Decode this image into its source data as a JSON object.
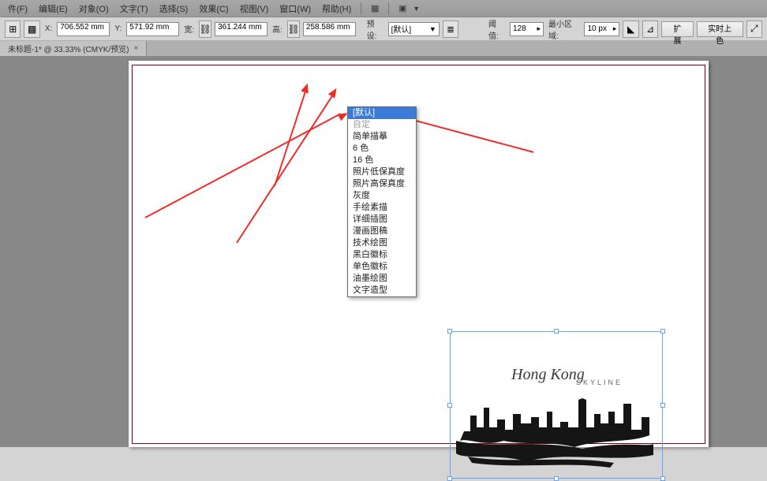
{
  "menu": [
    "件(F)",
    "编辑(E)",
    "对象(O)",
    "文字(T)",
    "选择(S)",
    "效果(C)",
    "视图(V)",
    "窗口(W)",
    "帮助(H)"
  ],
  "toolbar": {
    "x_label": "X:",
    "x_value": "706.552 mm",
    "y_label": "Y:",
    "y_value": "571.92 mm",
    "w_label": "宽:",
    "w_value": "361.244 mm",
    "h_label": "高:",
    "h_value": "258.586 mm",
    "preset_label": "预设:",
    "preset_value": "[默认]",
    "threshold_label": "阈值:",
    "threshold_value": "128",
    "minarea_label": "最小区域:",
    "minarea_value": "10 px",
    "expand_btn": "扩展",
    "live_btn": "实时上色"
  },
  "tab": {
    "title": "未标题-1* @ 33.33% (CMYK/预览)"
  },
  "dropdown": {
    "items": [
      "[默认]",
      "自定",
      "简单描摹",
      "6 色",
      "16 色",
      "照片低保真度",
      "照片高保真度",
      "灰度",
      "手绘素描",
      "详细插图",
      "漫画图稿",
      "技术绘图",
      "黑白徽标",
      "单色徽标",
      "油墨绘图",
      "文字造型"
    ],
    "selected_index": 0,
    "disabled_index": 1
  },
  "art": {
    "title": "Hong Kong",
    "subtitle": "SKYLINE"
  }
}
